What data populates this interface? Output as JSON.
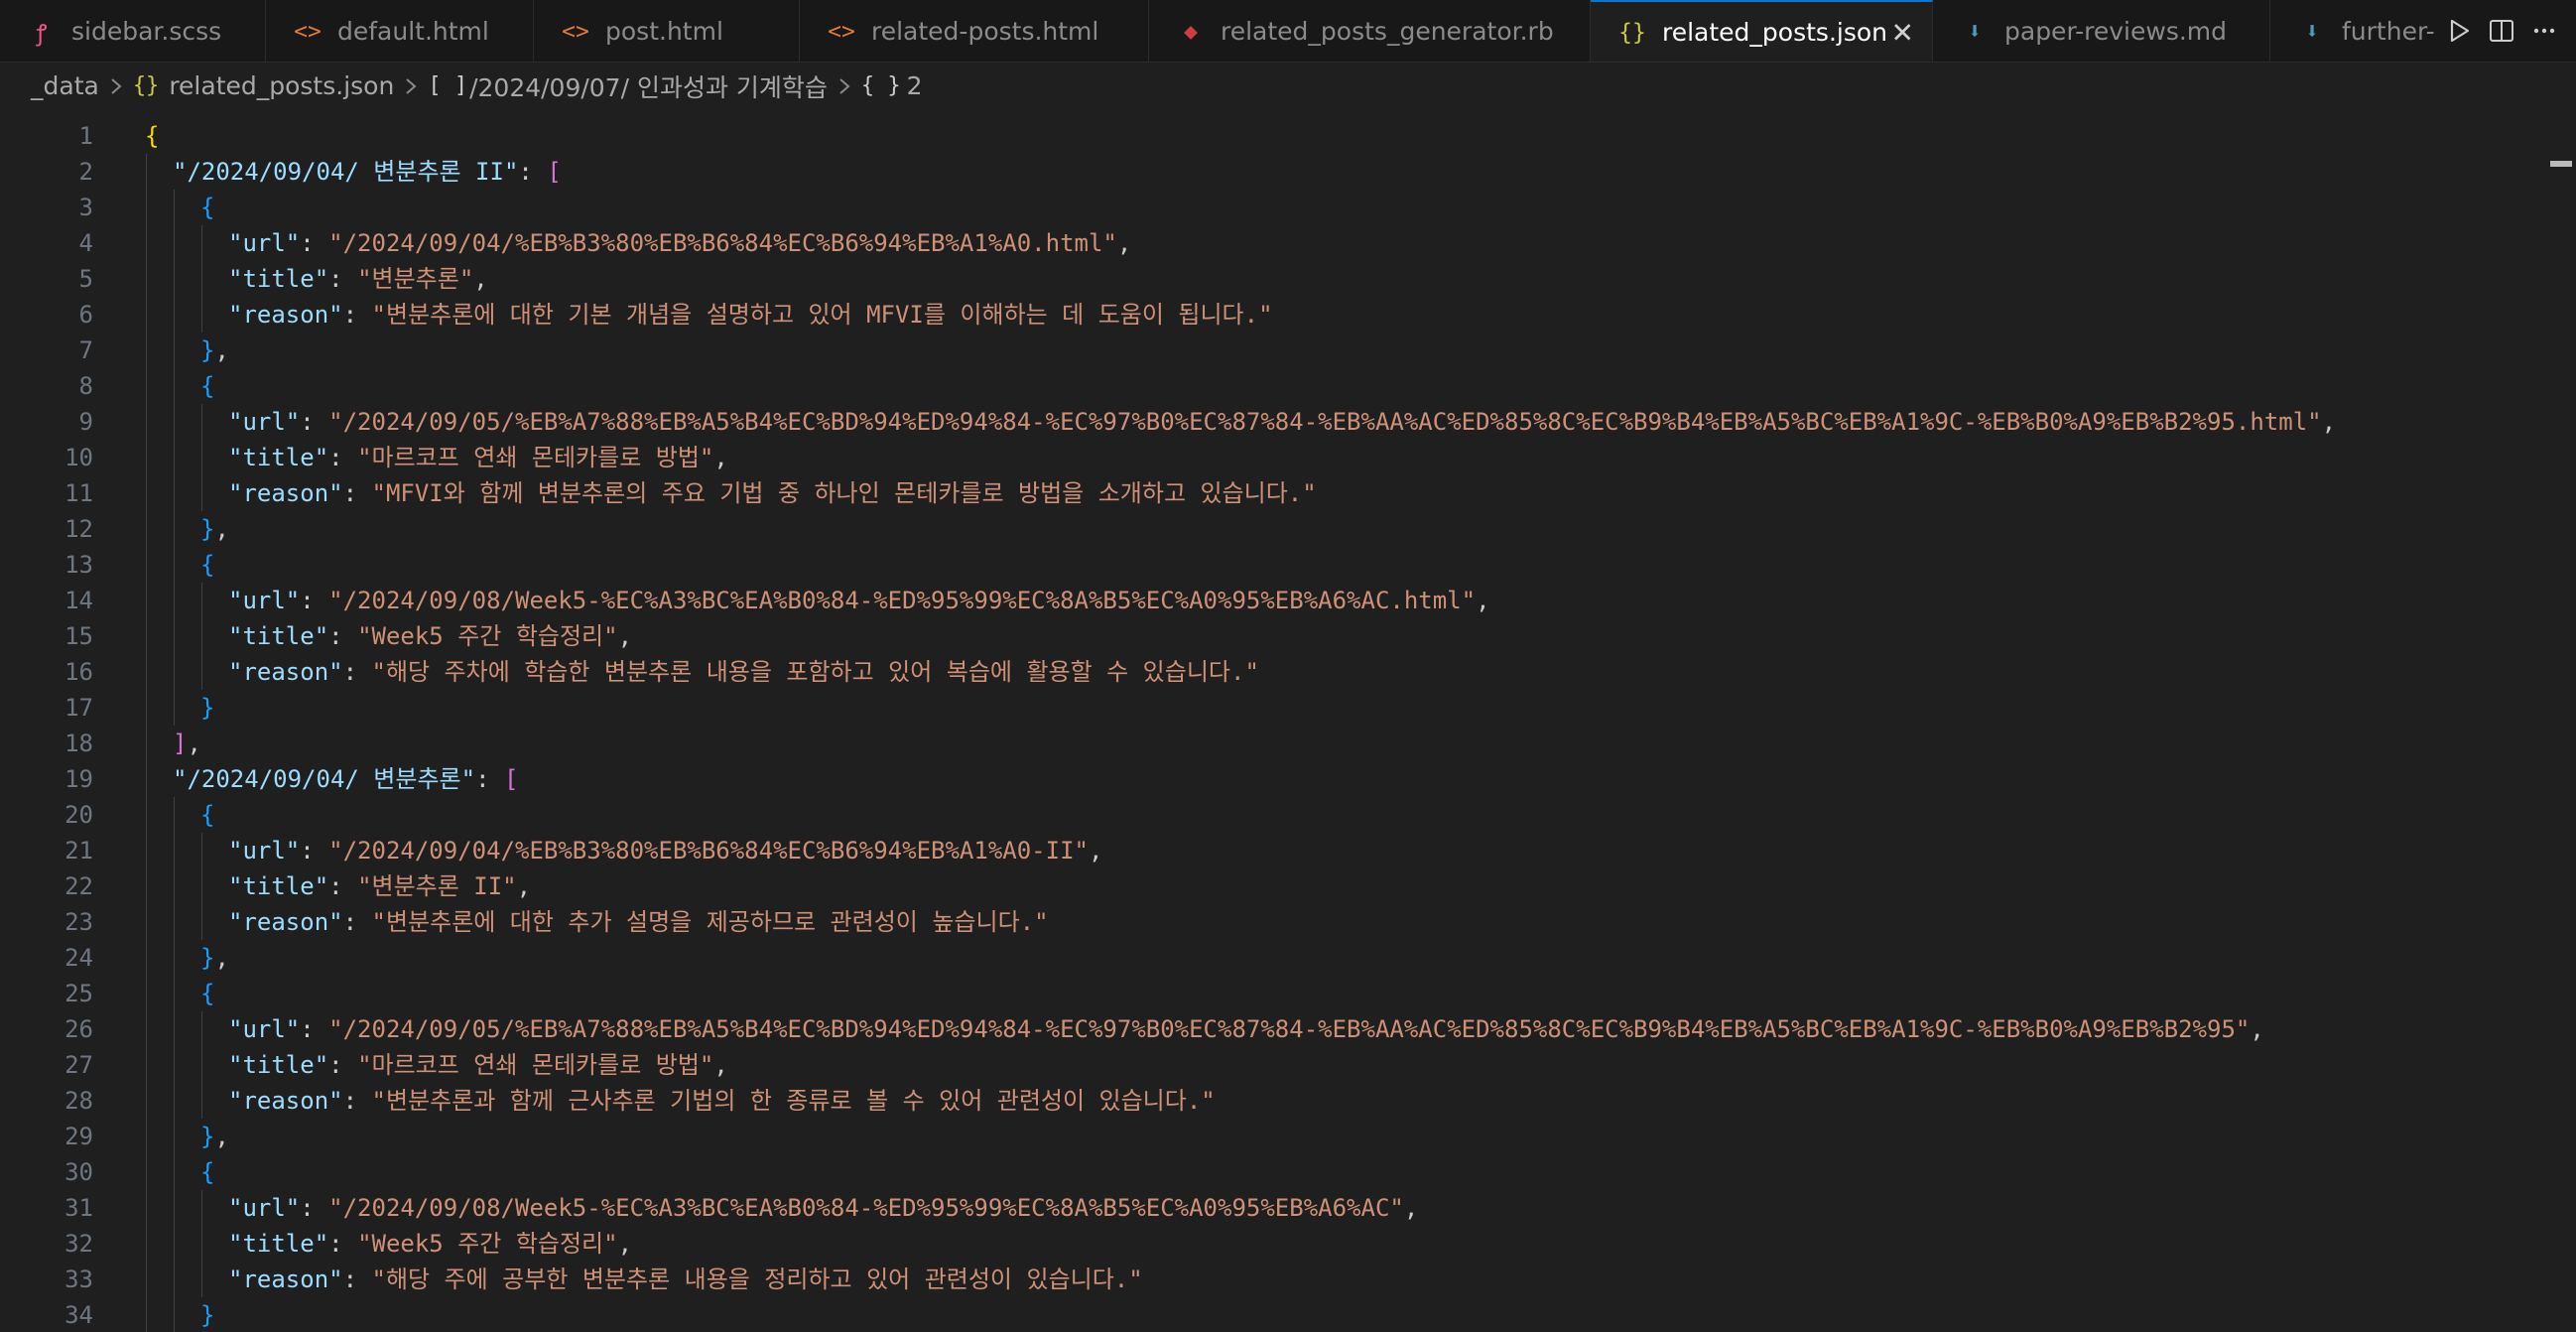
{
  "tabs": [
    {
      "label": "sidebar.scss",
      "icon": "sass-icon",
      "glyph": "ꝭ",
      "color": "#f55385",
      "active": false
    },
    {
      "label": "default.html",
      "icon": "html-icon",
      "glyph": "<>",
      "color": "#e37933",
      "active": false
    },
    {
      "label": "post.html",
      "icon": "html-icon",
      "glyph": "<>",
      "color": "#e37933",
      "active": false
    },
    {
      "label": "related-posts.html",
      "icon": "html-icon",
      "glyph": "<>",
      "color": "#e37933",
      "active": false
    },
    {
      "label": "related_posts_generator.rb",
      "icon": "ruby-icon",
      "glyph": "◆",
      "color": "#cc3e44",
      "active": false
    },
    {
      "label": "related_posts.json",
      "icon": "json-icon",
      "glyph": "{}",
      "color": "#cbcb41",
      "active": true
    },
    {
      "label": "paper-reviews.md",
      "icon": "markdown-icon",
      "glyph": "⬇",
      "color": "#519aba",
      "active": false
    },
    {
      "label": "further-",
      "icon": "markdown-icon",
      "glyph": "⬇",
      "color": "#519aba",
      "active": false
    }
  ],
  "tab_actions": {
    "run": "run-icon",
    "split": "split-editor-icon",
    "more": "more-actions-icon"
  },
  "breadcrumb": {
    "folder": "_data",
    "file": "related_posts.json",
    "file_glyph": "{}",
    "array_glyph": "[ ]",
    "key": "/2024/09/07/ 인과성과 기계학습",
    "object_glyph": "{ }",
    "index": "2"
  },
  "colors": {
    "key": "#9cdcfe",
    "string": "#ce9178",
    "bracket_level1": "#ffd700",
    "bracket_level2": "#da70d6",
    "bracket_level3": "#179fff",
    "accent": "#0078d4"
  },
  "code_lines": [
    {
      "n": "1",
      "indent": 0,
      "tokens": [
        [
          "b1",
          "{"
        ]
      ]
    },
    {
      "n": "2",
      "indent": 1,
      "tokens": [
        [
          "k",
          "\"/2024/09/04/ 변분추론 II\""
        ],
        [
          "p",
          ": "
        ],
        [
          "b2",
          "["
        ]
      ]
    },
    {
      "n": "3",
      "indent": 2,
      "tokens": [
        [
          "b3",
          "{"
        ]
      ]
    },
    {
      "n": "4",
      "indent": 3,
      "tokens": [
        [
          "k",
          "\"url\""
        ],
        [
          "p",
          ": "
        ],
        [
          "s",
          "\"/2024/09/04/%EB%B3%80%EB%B6%84%EC%B6%94%EB%A1%A0.html\""
        ],
        [
          "p",
          ","
        ]
      ]
    },
    {
      "n": "5",
      "indent": 3,
      "tokens": [
        [
          "k",
          "\"title\""
        ],
        [
          "p",
          ": "
        ],
        [
          "s",
          "\"변분추론\""
        ],
        [
          "p",
          ","
        ]
      ]
    },
    {
      "n": "6",
      "indent": 3,
      "tokens": [
        [
          "k",
          "\"reason\""
        ],
        [
          "p",
          ": "
        ],
        [
          "s",
          "\"변분추론에 대한 기본 개념을 설명하고 있어 MFVI를 이해하는 데 도움이 됩니다.\""
        ]
      ]
    },
    {
      "n": "7",
      "indent": 2,
      "tokens": [
        [
          "b3",
          "}"
        ],
        [
          "p",
          ","
        ]
      ]
    },
    {
      "n": "8",
      "indent": 2,
      "tokens": [
        [
          "b3",
          "{"
        ]
      ]
    },
    {
      "n": "9",
      "indent": 3,
      "tokens": [
        [
          "k",
          "\"url\""
        ],
        [
          "p",
          ": "
        ],
        [
          "s",
          "\"/2024/09/05/%EB%A7%88%EB%A5%B4%EC%BD%94%ED%94%84-%EC%97%B0%EC%87%84-%EB%AA%AC%ED%85%8C%EC%B9%B4%EB%A5%BC%EB%A1%9C-%EB%B0%A9%EB%B2%95.html\""
        ],
        [
          "p",
          ","
        ]
      ]
    },
    {
      "n": "10",
      "indent": 3,
      "tokens": [
        [
          "k",
          "\"title\""
        ],
        [
          "p",
          ": "
        ],
        [
          "s",
          "\"마르코프 연쇄 몬테카를로 방법\""
        ],
        [
          "p",
          ","
        ]
      ]
    },
    {
      "n": "11",
      "indent": 3,
      "tokens": [
        [
          "k",
          "\"reason\""
        ],
        [
          "p",
          ": "
        ],
        [
          "s",
          "\"MFVI와 함께 변분추론의 주요 기법 중 하나인 몬테카를로 방법을 소개하고 있습니다.\""
        ]
      ]
    },
    {
      "n": "12",
      "indent": 2,
      "tokens": [
        [
          "b3",
          "}"
        ],
        [
          "p",
          ","
        ]
      ]
    },
    {
      "n": "13",
      "indent": 2,
      "tokens": [
        [
          "b3",
          "{"
        ]
      ]
    },
    {
      "n": "14",
      "indent": 3,
      "tokens": [
        [
          "k",
          "\"url\""
        ],
        [
          "p",
          ": "
        ],
        [
          "s",
          "\"/2024/09/08/Week5-%EC%A3%BC%EA%B0%84-%ED%95%99%EC%8A%B5%EC%A0%95%EB%A6%AC.html\""
        ],
        [
          "p",
          ","
        ]
      ]
    },
    {
      "n": "15",
      "indent": 3,
      "tokens": [
        [
          "k",
          "\"title\""
        ],
        [
          "p",
          ": "
        ],
        [
          "s",
          "\"Week5 주간 학습정리\""
        ],
        [
          "p",
          ","
        ]
      ]
    },
    {
      "n": "16",
      "indent": 3,
      "tokens": [
        [
          "k",
          "\"reason\""
        ],
        [
          "p",
          ": "
        ],
        [
          "s",
          "\"해당 주차에 학습한 변분추론 내용을 포함하고 있어 복습에 활용할 수 있습니다.\""
        ]
      ]
    },
    {
      "n": "17",
      "indent": 2,
      "tokens": [
        [
          "b3",
          "}"
        ]
      ]
    },
    {
      "n": "18",
      "indent": 1,
      "tokens": [
        [
          "b2",
          "]"
        ],
        [
          "p",
          ","
        ]
      ]
    },
    {
      "n": "19",
      "indent": 1,
      "tokens": [
        [
          "k",
          "\"/2024/09/04/ 변분추론\""
        ],
        [
          "p",
          ": "
        ],
        [
          "b2",
          "["
        ]
      ]
    },
    {
      "n": "20",
      "indent": 2,
      "tokens": [
        [
          "b3",
          "{"
        ]
      ]
    },
    {
      "n": "21",
      "indent": 3,
      "tokens": [
        [
          "k",
          "\"url\""
        ],
        [
          "p",
          ": "
        ],
        [
          "s",
          "\"/2024/09/04/%EB%B3%80%EB%B6%84%EC%B6%94%EB%A1%A0-II\""
        ],
        [
          "p",
          ","
        ]
      ]
    },
    {
      "n": "22",
      "indent": 3,
      "tokens": [
        [
          "k",
          "\"title\""
        ],
        [
          "p",
          ": "
        ],
        [
          "s",
          "\"변분추론 II\""
        ],
        [
          "p",
          ","
        ]
      ]
    },
    {
      "n": "23",
      "indent": 3,
      "tokens": [
        [
          "k",
          "\"reason\""
        ],
        [
          "p",
          ": "
        ],
        [
          "s",
          "\"변분추론에 대한 추가 설명을 제공하므로 관련성이 높습니다.\""
        ]
      ]
    },
    {
      "n": "24",
      "indent": 2,
      "tokens": [
        [
          "b3",
          "}"
        ],
        [
          "p",
          ","
        ]
      ]
    },
    {
      "n": "25",
      "indent": 2,
      "tokens": [
        [
          "b3",
          "{"
        ]
      ]
    },
    {
      "n": "26",
      "indent": 3,
      "tokens": [
        [
          "k",
          "\"url\""
        ],
        [
          "p",
          ": "
        ],
        [
          "s",
          "\"/2024/09/05/%EB%A7%88%EB%A5%B4%EC%BD%94%ED%94%84-%EC%97%B0%EC%87%84-%EB%AA%AC%ED%85%8C%EC%B9%B4%EB%A5%BC%EB%A1%9C-%EB%B0%A9%EB%B2%95\""
        ],
        [
          "p",
          ","
        ]
      ]
    },
    {
      "n": "27",
      "indent": 3,
      "tokens": [
        [
          "k",
          "\"title\""
        ],
        [
          "p",
          ": "
        ],
        [
          "s",
          "\"마르코프 연쇄 몬테카를로 방법\""
        ],
        [
          "p",
          ","
        ]
      ]
    },
    {
      "n": "28",
      "indent": 3,
      "tokens": [
        [
          "k",
          "\"reason\""
        ],
        [
          "p",
          ": "
        ],
        [
          "s",
          "\"변분추론과 함께 근사추론 기법의 한 종류로 볼 수 있어 관련성이 있습니다.\""
        ]
      ]
    },
    {
      "n": "29",
      "indent": 2,
      "tokens": [
        [
          "b3",
          "}"
        ],
        [
          "p",
          ","
        ]
      ]
    },
    {
      "n": "30",
      "indent": 2,
      "tokens": [
        [
          "b3",
          "{"
        ]
      ]
    },
    {
      "n": "31",
      "indent": 3,
      "tokens": [
        [
          "k",
          "\"url\""
        ],
        [
          "p",
          ": "
        ],
        [
          "s",
          "\"/2024/09/08/Week5-%EC%A3%BC%EA%B0%84-%ED%95%99%EC%8A%B5%EC%A0%95%EB%A6%AC\""
        ],
        [
          "p",
          ","
        ]
      ]
    },
    {
      "n": "32",
      "indent": 3,
      "tokens": [
        [
          "k",
          "\"title\""
        ],
        [
          "p",
          ": "
        ],
        [
          "s",
          "\"Week5 주간 학습정리\""
        ],
        [
          "p",
          ","
        ]
      ]
    },
    {
      "n": "33",
      "indent": 3,
      "tokens": [
        [
          "k",
          "\"reason\""
        ],
        [
          "p",
          ": "
        ],
        [
          "s",
          "\"해당 주에 공부한 변분추론 내용을 정리하고 있어 관련성이 있습니다.\""
        ]
      ]
    },
    {
      "n": "34",
      "indent": 2,
      "tokens": [
        [
          "b3",
          "}"
        ]
      ]
    }
  ]
}
